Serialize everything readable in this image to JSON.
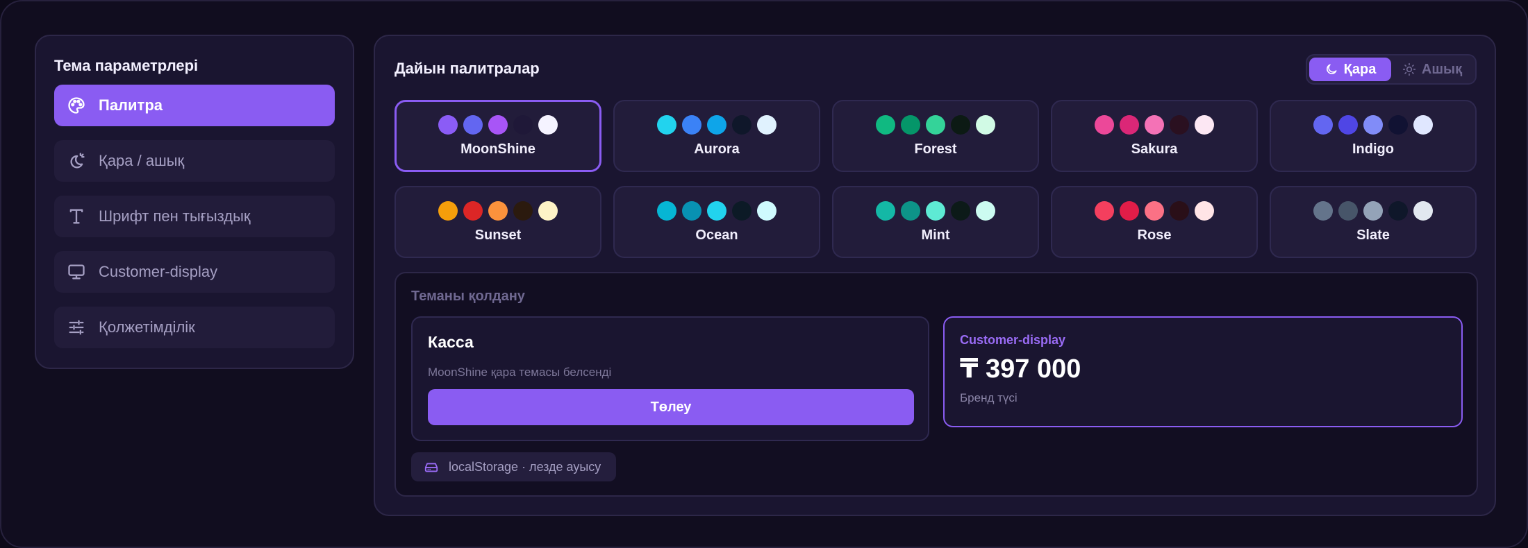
{
  "sidebar": {
    "title": "Тема параметрлері",
    "items": [
      {
        "label": "Палитра",
        "icon": "palette-icon",
        "active": true
      },
      {
        "label": "Қара / ашық",
        "icon": "sun-moon-icon",
        "active": false
      },
      {
        "label": "Шрифт пен тығыздық",
        "icon": "type-icon",
        "active": false
      },
      {
        "label": "Customer-display",
        "icon": "monitor-icon",
        "active": false
      },
      {
        "label": "Қолжетімділік",
        "icon": "sliders-icon",
        "active": false
      }
    ]
  },
  "main": {
    "title": "Дайын палитралар",
    "mode_toggle": {
      "dark_label": "Қара",
      "light_label": "Ашық",
      "selected": "dark"
    },
    "palettes": [
      {
        "name": "MoonShine",
        "selected": true,
        "colors": [
          "#8b5cf6",
          "#6366f1",
          "#a855f7",
          "#1f1838",
          "#f5f3ff"
        ]
      },
      {
        "name": "Aurora",
        "selected": false,
        "colors": [
          "#22d3ee",
          "#3b82f6",
          "#0ea5e9",
          "#0f172a",
          "#e0f2fe"
        ]
      },
      {
        "name": "Forest",
        "selected": false,
        "colors": [
          "#10b981",
          "#059669",
          "#34d399",
          "#0c1a14",
          "#d1fae5"
        ]
      },
      {
        "name": "Sakura",
        "selected": false,
        "colors": [
          "#ec4899",
          "#db2777",
          "#f472b6",
          "#2a1020",
          "#fce7f3"
        ]
      },
      {
        "name": "Indigo",
        "selected": false,
        "colors": [
          "#6366f1",
          "#4f46e5",
          "#818cf8",
          "#111233",
          "#e0e7ff"
        ]
      },
      {
        "name": "Sunset",
        "selected": false,
        "colors": [
          "#f59e0b",
          "#dc2626",
          "#fb923c",
          "#2b1a0e",
          "#fef3c7"
        ]
      },
      {
        "name": "Ocean",
        "selected": false,
        "colors": [
          "#06b6d4",
          "#0891b2",
          "#22d3ee",
          "#0c1a26",
          "#cffafe"
        ]
      },
      {
        "name": "Mint",
        "selected": false,
        "colors": [
          "#14b8a6",
          "#0d9488",
          "#5eead4",
          "#0c1a18",
          "#ccfbf1"
        ]
      },
      {
        "name": "Rose",
        "selected": false,
        "colors": [
          "#f43f5e",
          "#e11d48",
          "#fb7185",
          "#2a0f18",
          "#ffe4e6"
        ]
      },
      {
        "name": "Slate",
        "selected": false,
        "colors": [
          "#64748b",
          "#475569",
          "#94a3b8",
          "#0f172a",
          "#e2e8f0"
        ]
      }
    ],
    "preview": {
      "title": "Теманы қолдану",
      "kassa": {
        "title": "Касса",
        "subtitle": "MoonShine қара темасы белсенді",
        "button": "Төлеу"
      },
      "customer_display": {
        "label": "Customer-display",
        "amount": "₸ 397 000",
        "subtitle": "Бренд түсі"
      },
      "storage_chip": "localStorage · лезде ауысу"
    }
  },
  "colors": {
    "accent": "#8a5cf2",
    "background": "#110d1f",
    "panel": "#1a1530"
  }
}
